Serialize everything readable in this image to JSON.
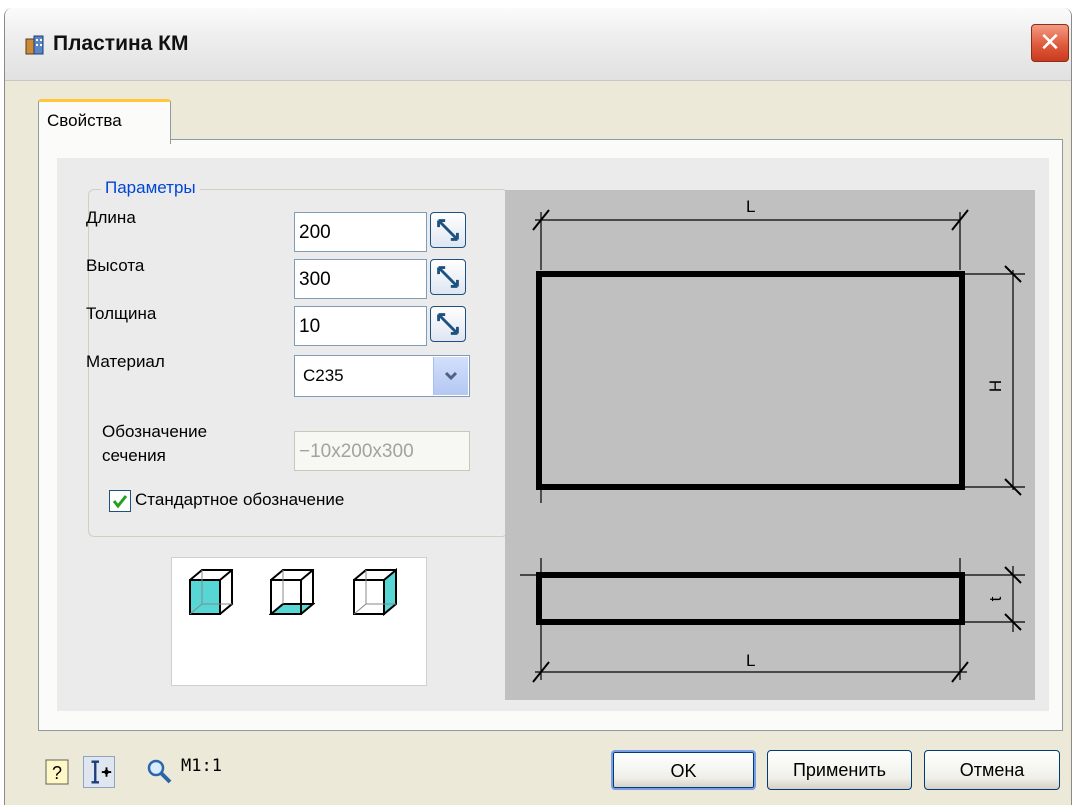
{
  "window": {
    "title": "Пластина КМ"
  },
  "tabs": [
    {
      "label": "Свойства"
    }
  ],
  "parameters": {
    "legend": "Параметры",
    "length": {
      "label": "Длина",
      "value": "200"
    },
    "height": {
      "label": "Высота",
      "value": "300"
    },
    "thickness": {
      "label": "Толщина",
      "value": "10"
    },
    "material": {
      "label": "Материал",
      "value": "С235"
    },
    "section": {
      "label_line1": "Обозначение",
      "label_line2": "сечения",
      "value": "−10x200x300"
    },
    "standard": {
      "label": "Стандартное обозначение",
      "checked": true
    }
  },
  "drawing": {
    "dim_L_top": "L",
    "dim_H": "H",
    "dim_t": "t",
    "dim_L_bottom": "L"
  },
  "footer": {
    "scale": "M1:1",
    "ok": "OK",
    "apply": "Применить",
    "cancel": "Отмена"
  },
  "colors": {
    "accent_blue": "#0046d5",
    "tab_highlight": "#ffc83c",
    "face_fill": "#57d6d6"
  }
}
